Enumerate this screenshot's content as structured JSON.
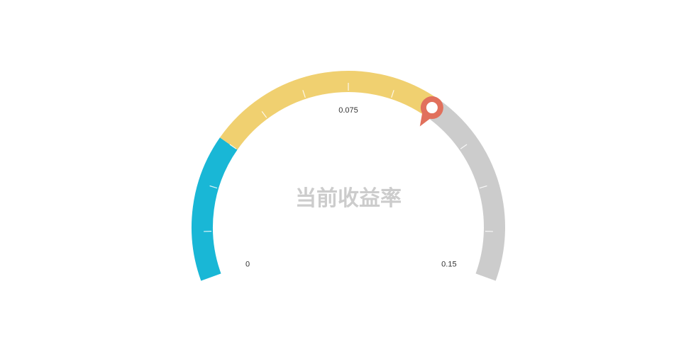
{
  "chart_data": {
    "type": "gauge",
    "title": "当前收益率",
    "min": 0,
    "max": 0.15,
    "value": 0.0988,
    "bands": [
      {
        "from": 0,
        "to": 0.0375,
        "color": "#19b7d6"
      },
      {
        "from": 0.0375,
        "to": 0.0975,
        "color": "#f0d070"
      },
      {
        "from": 0.0975,
        "to": 0.15,
        "color": "#cccccc"
      }
    ],
    "tick_labels": [
      {
        "value": 0,
        "label": "0"
      },
      {
        "value": 0.075,
        "label": "0.075"
      },
      {
        "value": 0.15,
        "label": "0.15"
      }
    ],
    "minor_ticks": [
      0.0125,
      0.025,
      0.0375,
      0.05,
      0.0625,
      0.075,
      0.0875,
      0.1,
      0.1125,
      0.125,
      0.1375
    ],
    "pointer_color": "#e1705c"
  }
}
